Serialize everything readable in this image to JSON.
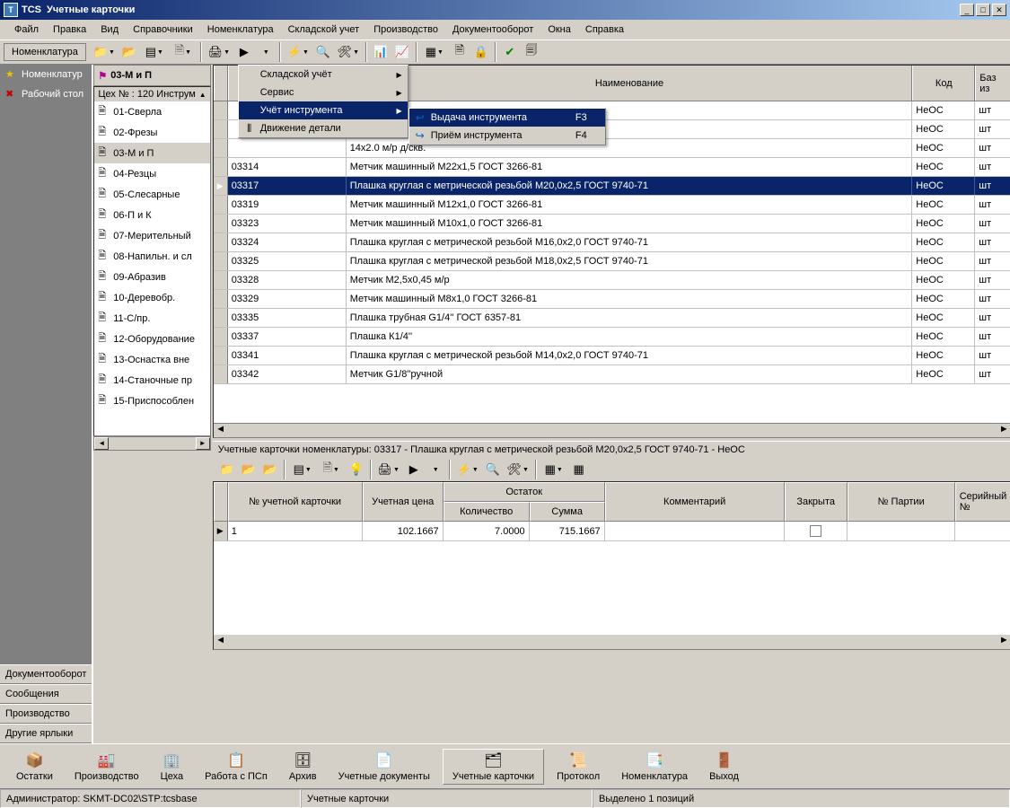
{
  "titlebar": {
    "app": "TCS",
    "title": "Учетные карточки"
  },
  "menubar": [
    "Файл",
    "Правка",
    "Вид",
    "Справочники",
    "Номенклатура",
    "Складской учет",
    "Производство",
    "Документооборот",
    "Окна",
    "Справка"
  ],
  "toolbar_label": "Номенклатура",
  "leftpanel": {
    "items": [
      {
        "label": "Номенклатур",
        "icon": "star"
      },
      {
        "label": "Рабочий стол",
        "icon": "wrench"
      }
    ],
    "bottom": [
      "Документооборот",
      "Сообщения",
      "Производство",
      "Другие ярлыки"
    ]
  },
  "tree": {
    "header": "03-М и П",
    "root": "Цех № : 120  Инструм",
    "nodes": [
      "01-Сверла",
      "02-Фрезы",
      "03-М и П",
      "04-Резцы",
      "05-Слесарные",
      "06-П и К",
      "07-Мерительный",
      "08-Напильн. и сл",
      "09-Абразив",
      "10-Деревобр.",
      "11-С/пр.",
      "12-Оборудование",
      "13-Оснастка вне",
      "14-Станочные пр",
      "15-Приспособлен"
    ],
    "selected_index": 2
  },
  "popup": {
    "items": [
      {
        "label": "Складской учёт",
        "sub": true
      },
      {
        "label": "Сервис",
        "sub": true
      },
      {
        "label": "Учёт инструмента",
        "sub": true,
        "selected": true
      },
      {
        "label": "Движение детали",
        "sub": false,
        "icon": "barcode"
      }
    ],
    "submenu": [
      {
        "label": "Выдача инструмента",
        "kb": "F3",
        "selected": true,
        "icon": "out"
      },
      {
        "label": "Приём инструмента",
        "kb": "F4",
        "icon": "in"
      }
    ]
  },
  "main_grid": {
    "headers": {
      "name": "Наименование",
      "code": "Код",
      "unit": "Баз из"
    },
    "partial_row": "14х2.0 м/р д/скв.",
    "rows": [
      {
        "code": "",
        "name": "",
        "kod": "НеОС",
        "unit": "шт"
      },
      {
        "code": "",
        "name": "",
        "kod": "НеОС",
        "unit": "шт"
      },
      {
        "code": "",
        "name": "14х2.0 м/р д/скв.",
        "kod": "НеОС",
        "unit": "шт"
      },
      {
        "code": "03314",
        "name": "Метчик машинный М22х1,5 ГОСТ 3266-81",
        "kod": "НеОС",
        "unit": "шт"
      },
      {
        "code": "03317",
        "name": "Плашка круглая с метрической резьбой М20,0х2,5 ГОСТ 9740-71",
        "kod": "НеОС",
        "unit": "шт",
        "selected": true
      },
      {
        "code": "03319",
        "name": "Метчик машинный М12х1,0 ГОСТ 3266-81",
        "kod": "НеОС",
        "unit": "шт"
      },
      {
        "code": "03323",
        "name": "Метчик машинный М10х1,0 ГОСТ 3266-81",
        "kod": "НеОС",
        "unit": "шт"
      },
      {
        "code": "03324",
        "name": "Плашка круглая с метрической резьбой М16,0х2,0 ГОСТ 9740-71",
        "kod": "НеОС",
        "unit": "шт"
      },
      {
        "code": "03325",
        "name": "Плашка круглая с метрической резьбой М18,0х2,5 ГОСТ 9740-71",
        "kod": "НеОС",
        "unit": "шт"
      },
      {
        "code": "03328",
        "name": "Метчик М2,5х0,45 м/р",
        "kod": "НеОС",
        "unit": "шт"
      },
      {
        "code": "03329",
        "name": "Метчик машинный М8х1,0 ГОСТ 3266-81",
        "kod": "НеОС",
        "unit": "шт"
      },
      {
        "code": "03335",
        "name": "Плашка трубная G1/4'' ГОСТ 6357-81",
        "kod": "НеОС",
        "unit": "шт"
      },
      {
        "code": "03337",
        "name": "Плашка К1/4''",
        "kod": "НеОС",
        "unit": "шт"
      },
      {
        "code": "03341",
        "name": "Плашка круглая с метрической резьбой М14,0х2,0 ГОСТ 9740-71",
        "kod": "НеОС",
        "unit": "шт"
      },
      {
        "code": "03342",
        "name": "Метчик G1/8''ручной",
        "kod": "НеОС",
        "unit": "шт"
      }
    ]
  },
  "detail": {
    "title": "Учетные карточки номенклатуры:   03317 - Плашка круглая с метрической резьбой М20,0х2,5 ГОСТ 9740-71 - НеОС",
    "headers": {
      "cardno": "№ учетной карточки",
      "price": "Учетная цена",
      "rest": "Остаток",
      "qty": "Количество",
      "sum": "Сумма",
      "comment": "Комментарий",
      "closed": "Закрыта",
      "batch": "№ Партии",
      "serial": "Серийный №"
    },
    "row": {
      "cardno": "1",
      "price": "102.1667",
      "qty": "7.0000",
      "sum": "715.1667",
      "comment": "",
      "closed": false,
      "batch": "",
      "serial": ""
    }
  },
  "app_tabs": [
    {
      "label": "Остатки",
      "icon": "📦"
    },
    {
      "label": "Производство",
      "icon": "🏭"
    },
    {
      "label": "Цеха",
      "icon": "🏢"
    },
    {
      "label": "Работа с ПСп",
      "icon": "📋"
    },
    {
      "label": "Архив",
      "icon": "🗄"
    },
    {
      "label": "Учетные документы",
      "icon": "📄"
    },
    {
      "label": "Учетные карточки",
      "icon": "🗂",
      "active": true
    },
    {
      "label": "Протокол",
      "icon": "📜"
    },
    {
      "label": "Номенклатура",
      "icon": "📑"
    },
    {
      "label": "Выход",
      "icon": "🚪"
    }
  ],
  "statusbar": {
    "admin": "Администратор: SKMT-DC02\\STP:tcsbase",
    "context": "Учетные карточки",
    "selection": "Выделено 1 позиций"
  }
}
